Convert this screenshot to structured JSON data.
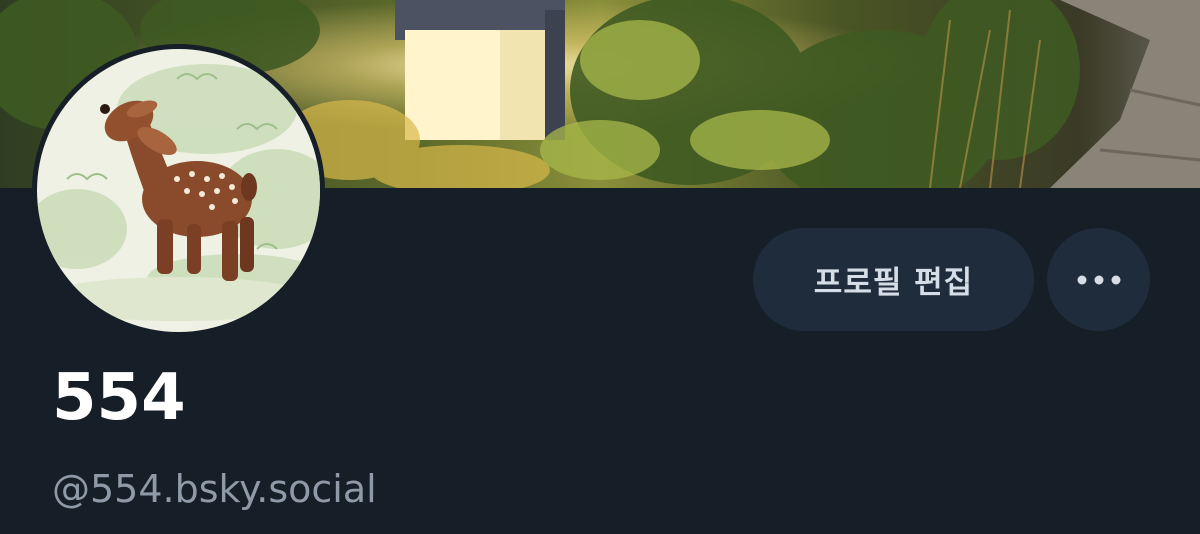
{
  "profile": {
    "display_name": "554",
    "handle": "@554.bsky.social"
  },
  "actions": {
    "edit_profile_label": "프로필 편집",
    "more_icon": "ellipsis-icon"
  },
  "colors": {
    "background": "#161e27",
    "button_bg": "#1f2c3c",
    "button_text": "#d5dde6",
    "handle_text": "#8e9aa8",
    "name_text": "#ffffff"
  }
}
